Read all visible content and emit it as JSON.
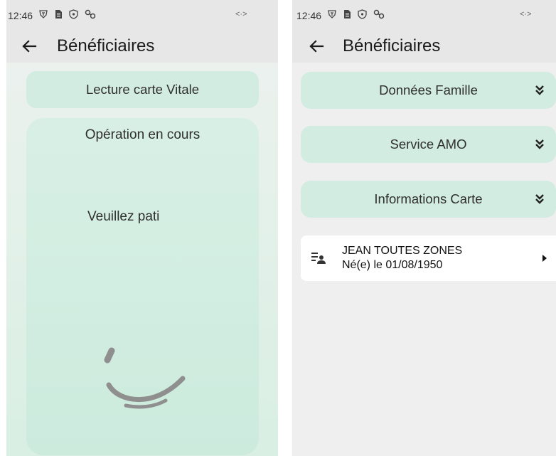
{
  "left_screen": {
    "status_time": "12:46",
    "status_right": "<·>",
    "title": "Bénéficiaires",
    "card_label": "Lecture carte Vitale",
    "operation_title": "Opération en cours",
    "operation_message": "Veuillez pati"
  },
  "right_screen": {
    "status_time": "12:46",
    "status_right": "<·>",
    "title": "Bénéficiaires",
    "sections": [
      {
        "label": "Données Famille",
        "icon": "chevron-double-down-icon"
      },
      {
        "label": "Service AMO",
        "icon": "chevron-double-down-icon"
      },
      {
        "label": "Informations Carte",
        "icon": "chevron-double-down-icon"
      }
    ],
    "beneficiary": {
      "name": "JEAN TOUTES ZONES",
      "birth": "Né(e) le  01/08/1950",
      "icon": "person-list-icon"
    }
  },
  "colors": {
    "pill_background": "#d2ece1",
    "header_background": "#e7e7e7",
    "spinner": "#8f8f8f"
  }
}
